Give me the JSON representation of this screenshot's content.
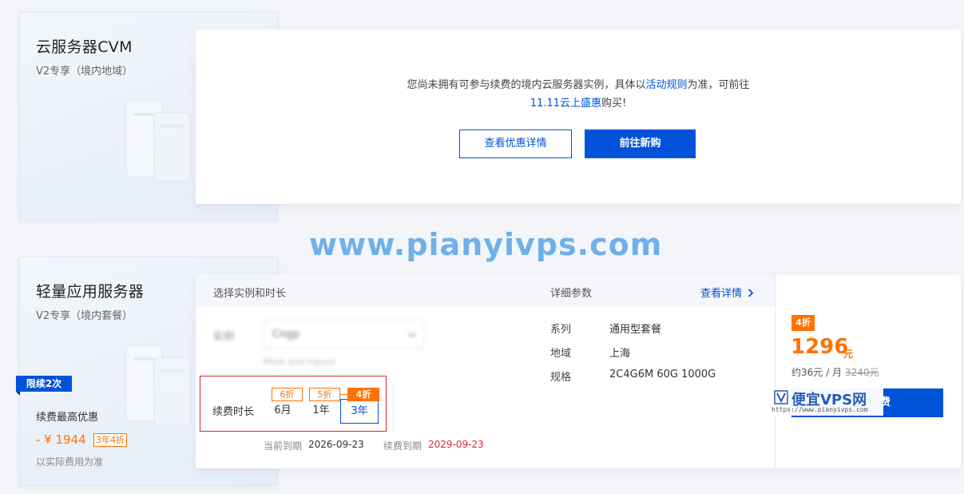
{
  "cvm_card": {
    "title": "云服务器CVM",
    "subtitle": "V2专享（境内地域）"
  },
  "cvm_notice": {
    "text_before": "您尚未拥有可参与续费的境内云服务器实例，具体以",
    "rules_link": "活动规则",
    "text_middle": "为准，可前往",
    "sale_link": "11.11云上盛惠",
    "text_after": "购买!",
    "btn_details": "查看优惠详情",
    "btn_buy_new": "前往新购"
  },
  "watermark": "www.pianyivps.com",
  "lighthouse_card": {
    "title": "轻量应用服务器",
    "subtitle": "V2专享（境内套餐）",
    "limit_badge": "限续2次",
    "max_discount_label": "续费最高优惠",
    "discount_amount": "- ¥ 1944",
    "discount_tag": "3年4折",
    "note": "以实际费用为准"
  },
  "buy_panel": {
    "header_left": "选择实例和时长",
    "header_params": "详细参数",
    "header_view_details": "查看详情",
    "instance_label": "实例",
    "instance_value": "Cngp",
    "instance_hint": "More and Inpure",
    "duration_label": "续费时长",
    "durations": [
      {
        "label": "6月",
        "tag": "6折"
      },
      {
        "label": "1年",
        "tag": "5折"
      },
      {
        "label": "3年",
        "tag": "4折"
      }
    ],
    "current_expire_label": "当前到期",
    "current_expire_date": "2026-09-23",
    "renew_expire_label": "续费到期",
    "renew_expire_date": "2029-09-23",
    "params": [
      {
        "label": "系列",
        "value": "通用型套餐"
      },
      {
        "label": "地域",
        "value": "上海"
      },
      {
        "label": "规格",
        "value": "2C4G6M 60G 1000G"
      }
    ]
  },
  "price": {
    "tag": "4折",
    "amount": "1296",
    "unit": "元",
    "per_month": "约36元 / 月",
    "original": "3240元",
    "buy_button": "费"
  },
  "site_logo": {
    "name": "便宜VPS网",
    "url": "https://www.pianyivps.com"
  },
  "colors": {
    "primary": "#0052d9",
    "accent": "#ff7200",
    "danger": "#e0252e"
  }
}
